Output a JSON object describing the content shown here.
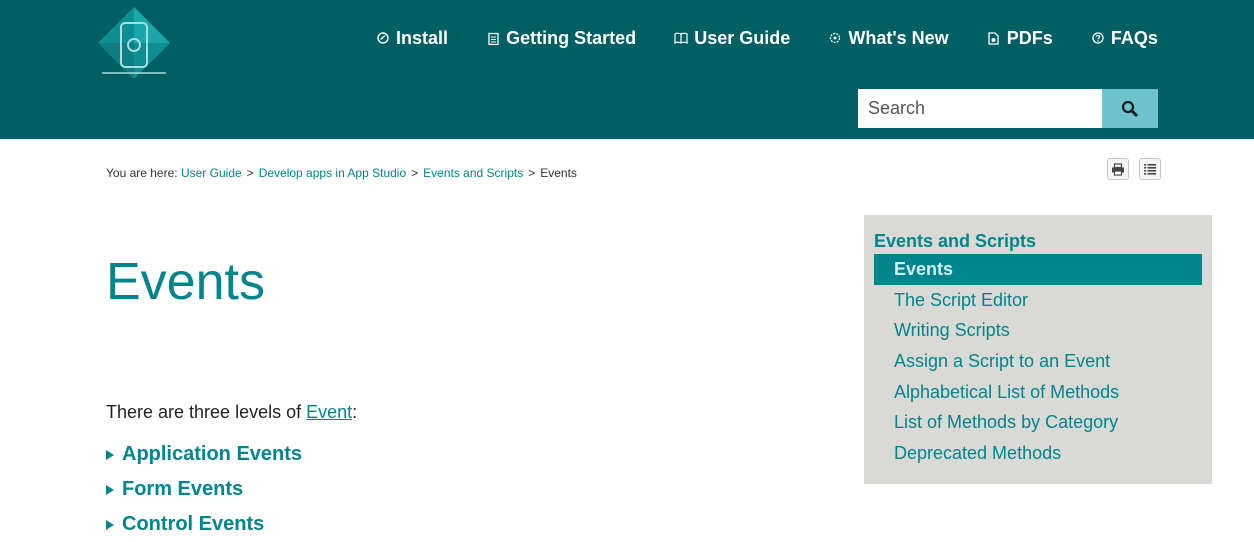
{
  "colors": {
    "header_bg": "#005f63",
    "accent": "#00858c",
    "search_button": "#6cc3cc",
    "sidebar_bg": "#d9dad6"
  },
  "logo": {
    "icon": "app-phone-diamond-logo"
  },
  "nav": {
    "items": [
      {
        "label": "Install",
        "icon": "install-icon"
      },
      {
        "label": "Getting Started",
        "icon": "getting-started-icon"
      },
      {
        "label": "User Guide",
        "icon": "book-icon"
      },
      {
        "label": "What's New",
        "icon": "whats-new-icon"
      },
      {
        "label": "PDFs",
        "icon": "pdf-icon"
      },
      {
        "label": "FAQs",
        "icon": "faq-icon"
      }
    ]
  },
  "search": {
    "placeholder": "Search",
    "value": "",
    "icon": "search-icon"
  },
  "breadcrumb": {
    "prefix": "You are here:",
    "links": [
      "User Guide",
      "Develop apps in App Studio",
      "Events and Scripts"
    ],
    "current": "Events",
    "separator": ">"
  },
  "toolbar": {
    "print_icon": "print-icon",
    "toc_icon": "list-icon"
  },
  "main": {
    "title": "Events",
    "intro_text": "There are three levels of ",
    "intro_link": "Event",
    "intro_suffix": ":",
    "expandables": [
      "Application Events",
      "Form Events",
      "Control Events"
    ]
  },
  "sidebar": {
    "title": "Events and Scripts",
    "active": "Events",
    "items": [
      "The Script Editor",
      "Writing Scripts",
      "Assign a Script to an Event",
      "Alphabetical List of Methods",
      "List of Methods by Category",
      "Deprecated Methods"
    ]
  }
}
